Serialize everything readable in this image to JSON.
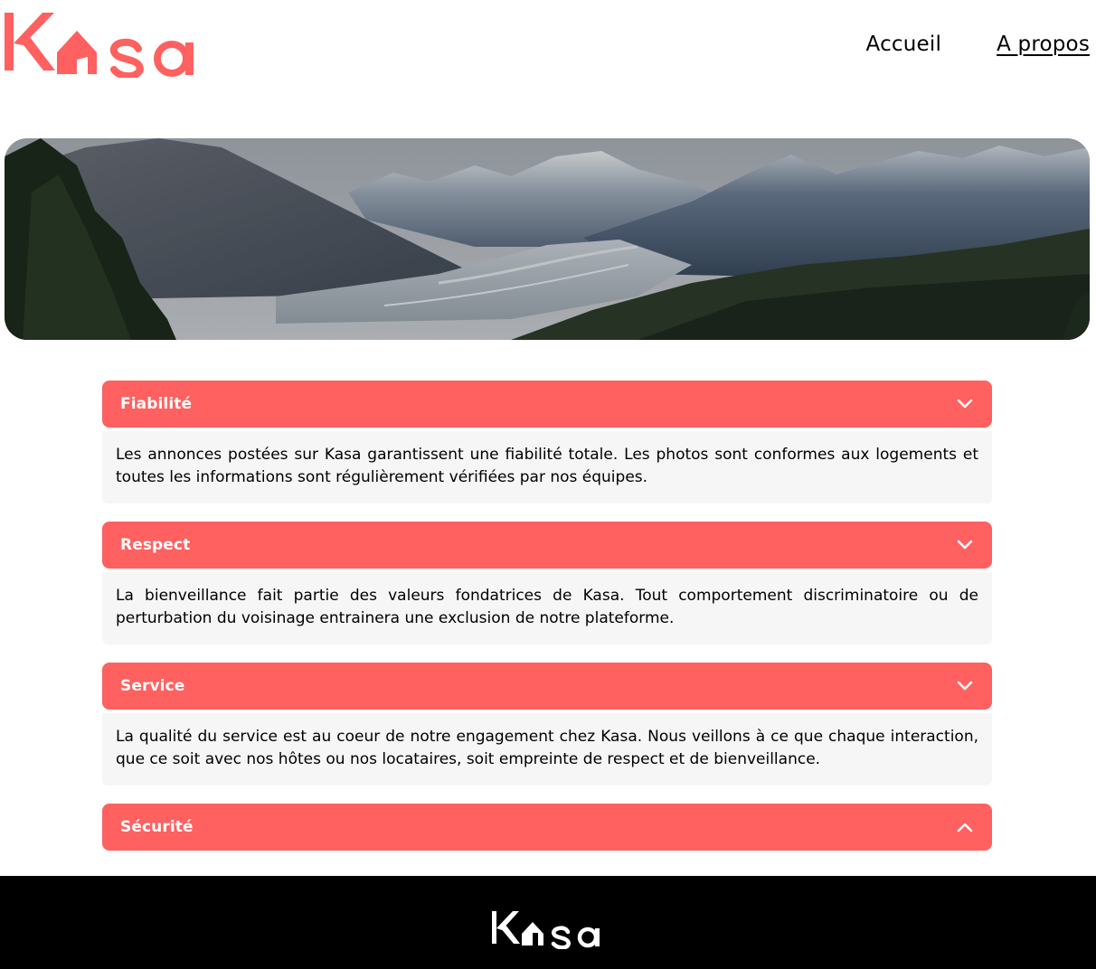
{
  "brand": {
    "logo_alt": "Kasa",
    "accent_color": "#FF6060",
    "footer_bg": "#000000",
    "body_bg": "#F6F6F6"
  },
  "nav": {
    "items": [
      {
        "label": "Accueil",
        "active": false
      },
      {
        "label": "A propos",
        "active": true
      }
    ]
  },
  "banner": {
    "image": "mountain-valley-landscape"
  },
  "collapses": [
    {
      "title": "Fiabilité",
      "expanded": true,
      "chevron": "chevron-down-icon",
      "text": "Les annonces postées sur Kasa garantissent une fiabilité totale. Les photos sont conformes aux logements et toutes les informations sont régulièrement vérifiées par nos équipes."
    },
    {
      "title": "Respect",
      "expanded": true,
      "chevron": "chevron-down-icon",
      "text": "La bienveillance fait partie des valeurs fondatrices de Kasa. Tout comportement discriminatoire ou de perturbation du voisinage entrainera une exclusion de notre plateforme."
    },
    {
      "title": "Service",
      "expanded": true,
      "chevron": "chevron-down-icon",
      "text": "La qualité du service est au coeur de notre engagement chez Kasa. Nous veillons à ce que chaque interaction, que ce soit avec nos hôtes ou nos locataires, soit empreinte de respect et de bienveillance."
    },
    {
      "title": "Sécurité",
      "expanded": false,
      "chevron": "chevron-up-icon",
      "text": ""
    }
  ]
}
